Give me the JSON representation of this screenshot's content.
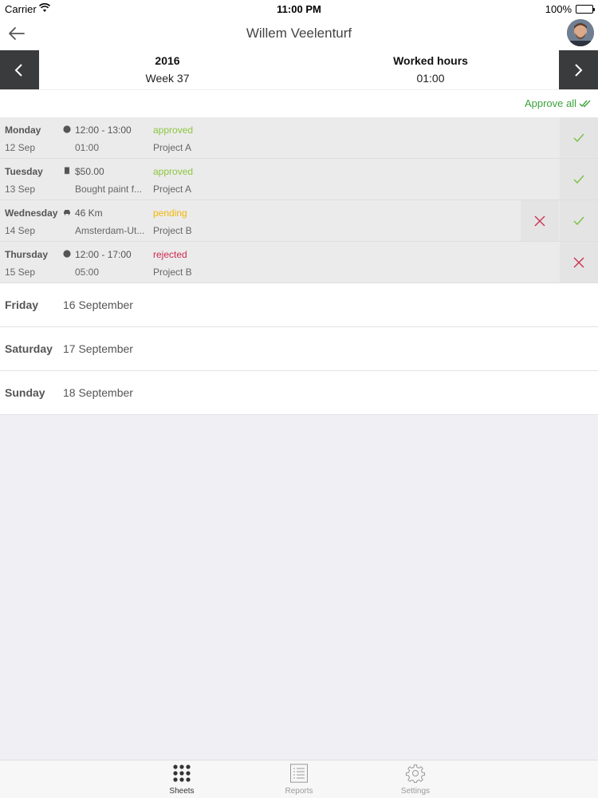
{
  "status_bar": {
    "carrier": "Carrier",
    "time": "11:00 PM",
    "battery": "100%",
    "battery_level": 1.0
  },
  "nav": {
    "title": "Willem Veelenturf",
    "back_icon": "back-arrow-icon",
    "avatar_icon": "user-avatar"
  },
  "week": {
    "year": "2016",
    "week_label": "Week 37",
    "hours_label": "Worked hours",
    "hours_value": "01:00"
  },
  "approve_all": "Approve all",
  "colors": {
    "approved": "#8cc63f",
    "pending": "#f2b705",
    "rejected": "#d0284c",
    "approve_check": "#7ec24a",
    "reject_x": "#cc3a55",
    "approve_all": "#3aa23a"
  },
  "entries": [
    {
      "day": "Monday",
      "date": "12 Sep",
      "icon": "clock-icon",
      "line1": "12:00 - 13:00",
      "line2": "01:00",
      "status": "approved",
      "project": "Project A"
    },
    {
      "day": "Tuesday",
      "date": "13 Sep",
      "icon": "receipt-icon",
      "line1": "$50.00",
      "line2": "Bought paint f...",
      "status": "approved",
      "project": "Project A"
    },
    {
      "day": "Wednesday",
      "date": "14 Sep",
      "icon": "car-icon",
      "line1": "46 Km",
      "line2": "Amsterdam-Ut...",
      "status": "pending",
      "project": "Project B"
    },
    {
      "day": "Thursday",
      "date": "15 Sep",
      "icon": "clock-icon",
      "line1": "12:00 - 17:00",
      "line2": "05:00",
      "status": "rejected",
      "project": "Project B"
    }
  ],
  "empty_days": [
    {
      "day": "Friday",
      "date": "16 September"
    },
    {
      "day": "Saturday",
      "date": "17 September"
    },
    {
      "day": "Sunday",
      "date": "18 September"
    }
  ],
  "tabs": [
    {
      "label": "Sheets",
      "icon": "grid-icon",
      "active": true
    },
    {
      "label": "Reports",
      "icon": "list-icon",
      "active": false
    },
    {
      "label": "Settings",
      "icon": "gear-icon",
      "active": false
    }
  ]
}
